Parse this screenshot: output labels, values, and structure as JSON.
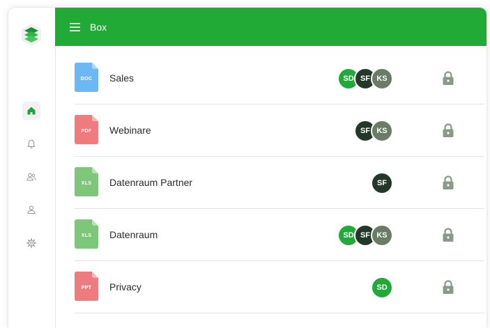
{
  "header": {
    "title": "Box"
  },
  "colors": {
    "brand": "#21aa35",
    "doc": "#6cb8f5",
    "pdf": "#f07b7f",
    "xls": "#7dc67a",
    "ppt": "#f07b7f",
    "SD": "#23a83a",
    "SF": "#24382a",
    "KS": "#6a7b66",
    "lock": "#8a9a86"
  },
  "sidebar": {
    "items": [
      {
        "icon": "home-icon",
        "active": true
      },
      {
        "icon": "bell-icon",
        "active": false
      },
      {
        "icon": "users-icon",
        "active": false
      },
      {
        "icon": "user-icon",
        "active": false
      },
      {
        "icon": "gear-icon",
        "active": false
      }
    ]
  },
  "files": [
    {
      "name": "Sales",
      "type": "DOC",
      "members": [
        "SD",
        "SF",
        "KS"
      ],
      "locked": true
    },
    {
      "name": "Webinare",
      "type": "PDF",
      "members": [
        "SF",
        "KS"
      ],
      "locked": true
    },
    {
      "name": "Datenraum Partner",
      "type": "XLS",
      "members": [
        "SF"
      ],
      "locked": true
    },
    {
      "name": "Datenraum",
      "type": "XLS",
      "members": [
        "SD",
        "SF",
        "KS"
      ],
      "locked": true
    },
    {
      "name": "Privacy",
      "type": "PPT",
      "members": [
        "SD"
      ],
      "locked": true
    }
  ]
}
